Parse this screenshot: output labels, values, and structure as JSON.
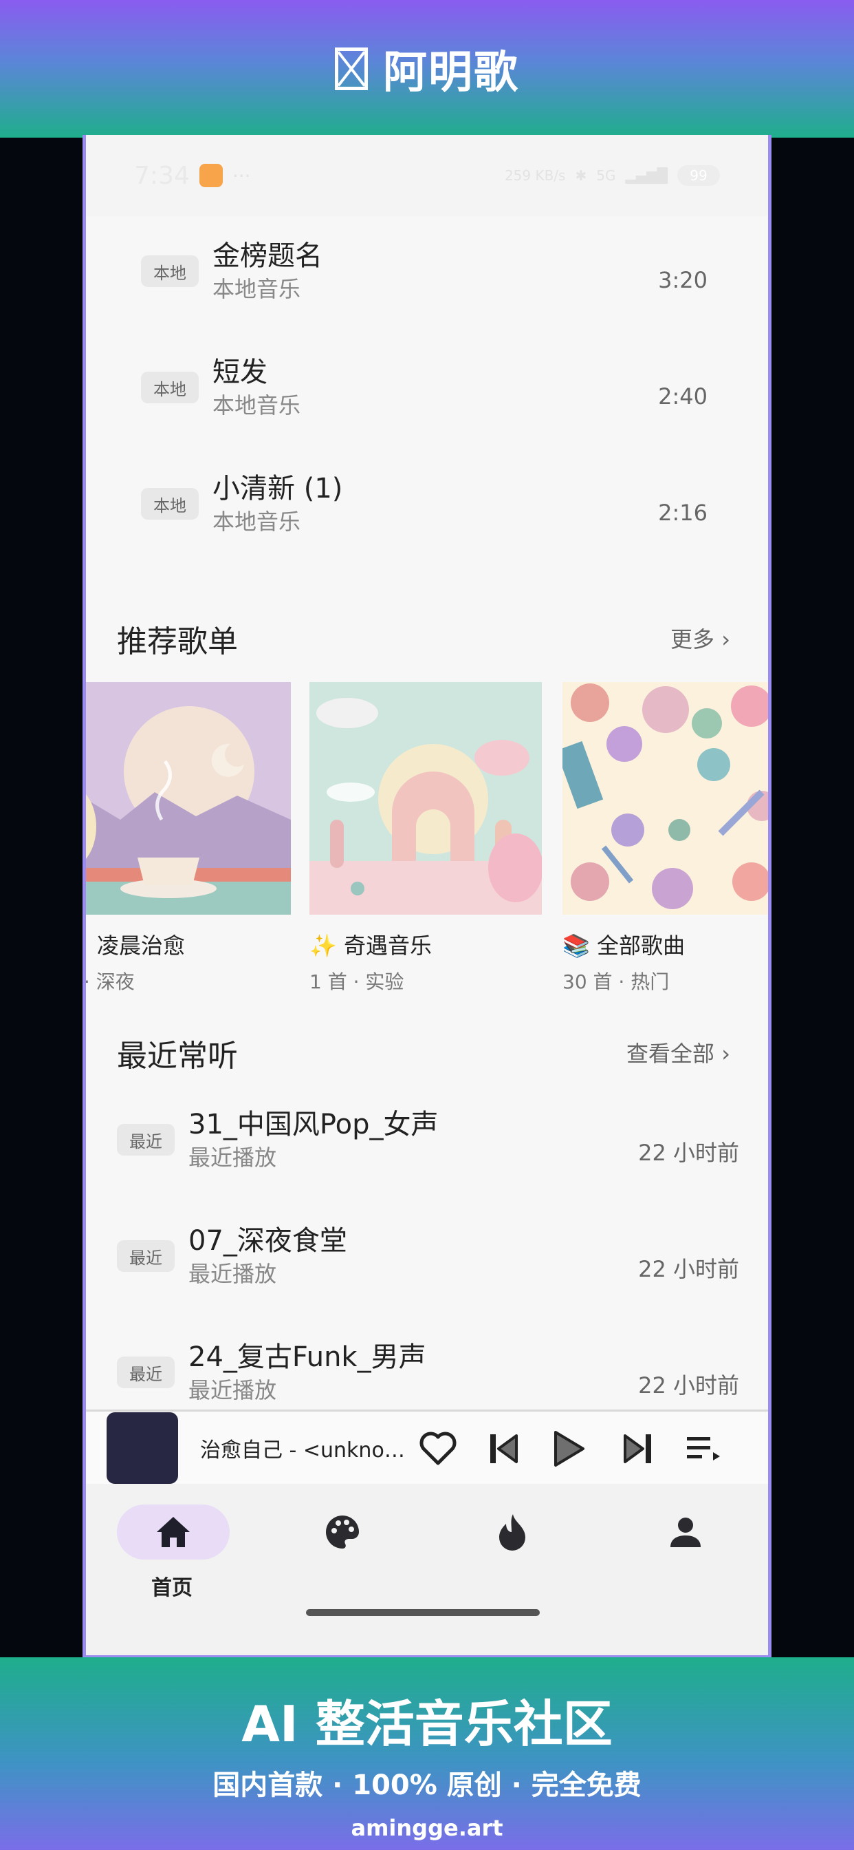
{
  "banner": {
    "app_name": "阿明歌",
    "tagline": "AI 整活音乐社区",
    "subtagline": "国内首款 · 100% 原创 · 完全免费",
    "domain": "amingge.art"
  },
  "status_bar": {
    "time": "7:34",
    "dots": "···",
    "net_speed": "259 KB/s",
    "signal": "5G",
    "battery": "99"
  },
  "local_songs": [
    {
      "tag": "本地",
      "title": "金榜题名",
      "subtitle": "本地音乐",
      "duration": "3:20"
    },
    {
      "tag": "本地",
      "title": "短发",
      "subtitle": "本地音乐",
      "duration": "2:40"
    },
    {
      "tag": "本地",
      "title": "小清新 (1)",
      "subtitle": "本地音乐",
      "duration": "2:16"
    }
  ],
  "recommended": {
    "title": "推荐歌单",
    "more": "更多 ›",
    "playlists": [
      {
        "title": "凌晨治愈",
        "subtitle": "首 · 深夜"
      },
      {
        "title": "✨ 奇遇音乐",
        "subtitle": "1 首 · 实验"
      },
      {
        "title": "📚 全部歌曲",
        "subtitle": "30 首 · 热门"
      }
    ]
  },
  "recent": {
    "title": "最近常听",
    "more": "查看全部 ›",
    "items": [
      {
        "tag": "最近",
        "title": "31_中国风Pop_女声",
        "subtitle": "最近播放",
        "time": "22 小时前"
      },
      {
        "tag": "最近",
        "title": "07_深夜食堂",
        "subtitle": "最近播放",
        "time": "22 小时前"
      },
      {
        "tag": "最近",
        "title": "24_复古Funk_男声",
        "subtitle": "最近播放",
        "time": "22 小时前"
      }
    ]
  },
  "player": {
    "now_playing": "治愈自己 - <unknown>"
  },
  "nav": {
    "home": "首页"
  },
  "colors": {
    "accent": "#e8dcf6",
    "cover": "#272744"
  }
}
